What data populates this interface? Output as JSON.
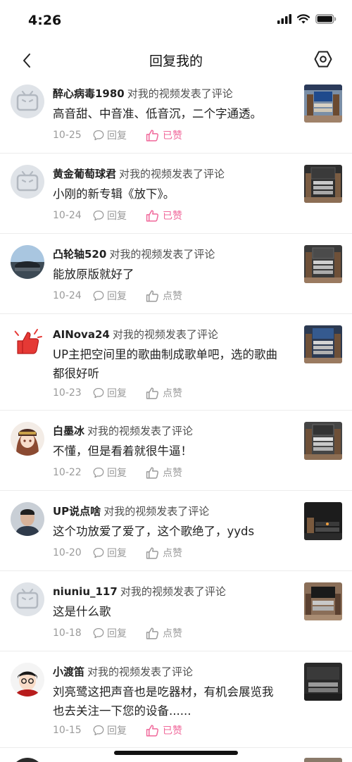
{
  "status": {
    "time": "4:26"
  },
  "nav": {
    "title": "回复我的"
  },
  "action_text": "对我的视频发表了评论",
  "reply_label": "回复",
  "colors": {
    "liked": "#f0679a",
    "meta": "#9a9a9a",
    "divider": "#ececec"
  },
  "items": [
    {
      "user": "醉心病毒1980",
      "body": [
        "高音甜、中音准、低音沉，二个字通透。"
      ],
      "date": "10-25",
      "like": "已赞",
      "liked": true,
      "avatar": "tv-avatar-icon"
    },
    {
      "user": "黄金葡萄球君",
      "body": [
        "小刚的新专辑《放下》。"
      ],
      "date": "10-24",
      "like": "已赞",
      "liked": true,
      "avatar": "tv-avatar-icon"
    },
    {
      "user": "凸轮轴520",
      "body": [
        "能放原版就好了"
      ],
      "date": "10-24",
      "like": "点赞",
      "liked": false,
      "avatar": "photo-avatar"
    },
    {
      "user": "AINova24",
      "body": [
        "UP主把空间里的歌曲制成歌单吧，选的歌曲",
        "都很好听"
      ],
      "date": "10-23",
      "like": "点赞",
      "liked": false,
      "avatar": "thumbs-up-avatar"
    },
    {
      "user": "白墨冰",
      "body": [
        "不懂，但是看着就很牛逼！"
      ],
      "date": "10-22",
      "like": "点赞",
      "liked": false,
      "avatar": "anime-avatar"
    },
    {
      "user": "UP说点啥",
      "body": [
        "这个功放爱了爱了，这个歌绝了，yyds"
      ],
      "date": "10-20",
      "like": "点赞",
      "liked": false,
      "avatar": "photo-avatar"
    },
    {
      "user": "niuniu_117",
      "body": [
        "这是什么歌"
      ],
      "date": "10-18",
      "like": "点赞",
      "liked": false,
      "avatar": "tv-avatar-icon"
    },
    {
      "user": "小渡笛",
      "body": [
        "刘亮鹭这把声音也是吃器材，有机会展览我",
        "也去关注一下您的设备......"
      ],
      "date": "10-15",
      "like": "已赞",
      "liked": true,
      "avatar": "cartoon-avatar"
    }
  ]
}
